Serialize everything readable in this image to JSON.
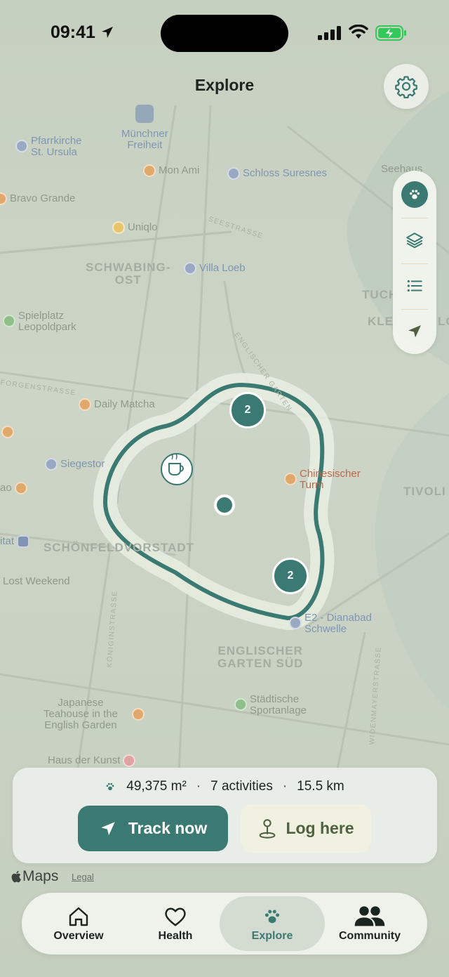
{
  "status_bar": {
    "time": "09:41"
  },
  "header": {
    "title": "Explore"
  },
  "map": {
    "labels": {
      "muenchner_freiheit": "Münchner\nFreiheit",
      "pfarrkirche": "Pfarrkirche\nSt. Ursula",
      "mon_ami": "Mon Ami",
      "schloss": "Schloss Suresnes",
      "seehaus": "Seehaus",
      "bravo": "Bravo Grande",
      "uniqlo": "Uniqlo",
      "seestrasse": "SEESTRASSE",
      "schwabing": "SCHWABING-\nOST",
      "villa_loeb": "Villa Loeb",
      "tuch": "TUCH",
      "klei": "KLEI",
      "lo": "LO",
      "spielplatz": "Spielplatz\nLeopoldpark",
      "englischer_garten_street": "ENGLISCHER GARTEN",
      "forgenstrasse": "FORGENSTRASSE",
      "daily_matcha": "Daily Matcha",
      "siegestor": "Siegestor",
      "chinesischer_turm": "Chinesischer\nTurm",
      "tivoli": "TIVOLI",
      "ao": "ao",
      "itat": "itat",
      "schoenfeldvorstadt": "SCHÖNFELDVORSTADT",
      "lost_weekend": "Lost Weekend",
      "e2_dianabad": "E2 - Dianabad\nSchwelle",
      "koeniginstrasse": "KÖNIGINSTRASSE",
      "englischer_garten_sued": "ENGLISCHER\nGARTEN SÜD",
      "wiedenmayerstrasse": "WIDENMAYERSTRASSE",
      "japanese_teahouse": "Japanese\nTeahouse in the\nEnglish Garden",
      "staedtische": "Städtische\nSportanlage",
      "haus_der_kunst": "Haus der Kunst"
    },
    "clusters": [
      {
        "count": "2"
      },
      {
        "count": "2"
      }
    ]
  },
  "side_panel": {
    "items": [
      "paw-icon",
      "layers-icon",
      "list-icon",
      "location-arrow-icon"
    ]
  },
  "stats": {
    "area": "49,375 m²",
    "activities": "7 activities",
    "distance": "15.5 km",
    "separator": "·"
  },
  "actions": {
    "track_label": "Track now",
    "log_label": "Log here"
  },
  "credit": {
    "maps": "Maps",
    "legal": "Legal"
  },
  "tabs": [
    {
      "label": "Overview",
      "icon": "home-icon"
    },
    {
      "label": "Health",
      "icon": "heart-icon"
    },
    {
      "label": "Explore",
      "icon": "paw-icon",
      "active": true
    },
    {
      "label": "Community",
      "icon": "people-icon"
    }
  ],
  "colors": {
    "accent": "#3b7a72",
    "log_button_bg": "#f0f1e0",
    "log_button_text": "#4e6240",
    "battery": "#34c759"
  }
}
